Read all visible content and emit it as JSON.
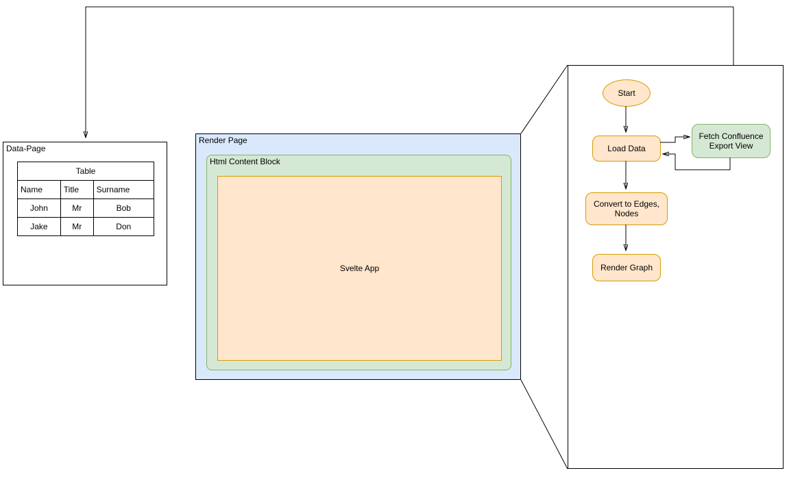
{
  "dataPage": {
    "label": "Data-Page",
    "tableTitle": "Table",
    "columns": [
      "Name",
      "Title",
      "Surname"
    ],
    "rows": [
      [
        "John",
        "Mr",
        "Bob"
      ],
      [
        "Jake",
        "Mr",
        "Don"
      ]
    ]
  },
  "renderPage": {
    "label": "Render Page",
    "htmlBlockLabel": "Html Content Block",
    "svelteAppLabel": "Svelte App"
  },
  "flow": {
    "start": "Start",
    "loadData": "Load Data",
    "fetch": "Fetch Confluence Export View",
    "convert": "Convert to Edges, Nodes",
    "render": "Render Graph"
  }
}
